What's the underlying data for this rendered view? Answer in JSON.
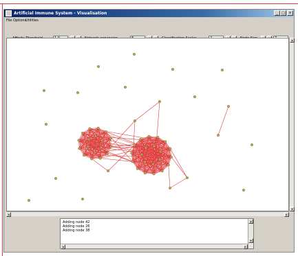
{
  "window": {
    "title": "Artificial Immune System - Visualisation",
    "minimize_glyph": "_",
    "maximize_glyph": "□",
    "close_glyph": "×"
  },
  "menu": [
    "File",
    "Options",
    "Utilities"
  ],
  "toolbar": {
    "affinity_label": "Affinity Threshold",
    "affinity_value": "1.0",
    "expansion_label": "Network expansion",
    "expansion_value": "8",
    "classification_label": "Classification Scalar",
    "classification_value": "2",
    "node_size_label": "Node Size",
    "node_size_value": "7",
    "dec_glyph": "◂",
    "inc_glyph": "▸"
  },
  "log": {
    "lines": [
      "Adding node 42",
      "Adding node 26",
      "Adding node 38"
    ]
  },
  "colors": {
    "node_fill": "#b8a05a",
    "node_stroke": "#7a6a30",
    "edge": "#e04040"
  },
  "icons": [
    "window-icon",
    "minimize-icon",
    "maximize-icon",
    "close-icon",
    "arrow-left-icon",
    "arrow-right-icon",
    "arrow-up-icon",
    "arrow-down-icon"
  ]
}
